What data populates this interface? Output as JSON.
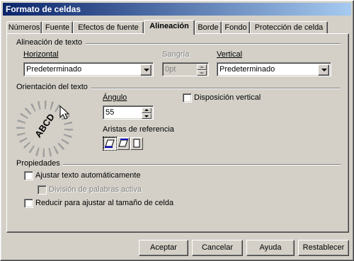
{
  "window": {
    "title": "Formato de celdas"
  },
  "tabs": [
    {
      "label": "Números"
    },
    {
      "label": "Fuente"
    },
    {
      "label": "Efectos de fuente"
    },
    {
      "label": "Alineación"
    },
    {
      "label": "Borde"
    },
    {
      "label": "Fondo"
    },
    {
      "label": "Protección de celda"
    }
  ],
  "alignment": {
    "section_title": "Alineación de texto",
    "horizontal_label": "Horizontal",
    "horizontal_value": "Predeterminado",
    "indent_label": "Sangría",
    "indent_value": "0pt",
    "vertical_label": "Vertical",
    "vertical_value": "Predeterminado"
  },
  "orientation": {
    "section_title": "Orientación del texto",
    "dial_text": "ABCD",
    "angle_label": "Ángulo",
    "angle_value": "55",
    "vertical_stacking_label": "Disposición vertical",
    "reference_edges_label": "Aristas de referencia"
  },
  "properties": {
    "section_title": "Propiedades",
    "wrap_label": "Ajustar texto automáticamente",
    "hyphenation_label": "División de palabras activa",
    "shrink_label": "Reducir para ajustar al tamaño de celda"
  },
  "buttons": {
    "ok": "Aceptar",
    "cancel": "Cancelar",
    "help": "Ayuda",
    "reset": "Restablecer"
  }
}
